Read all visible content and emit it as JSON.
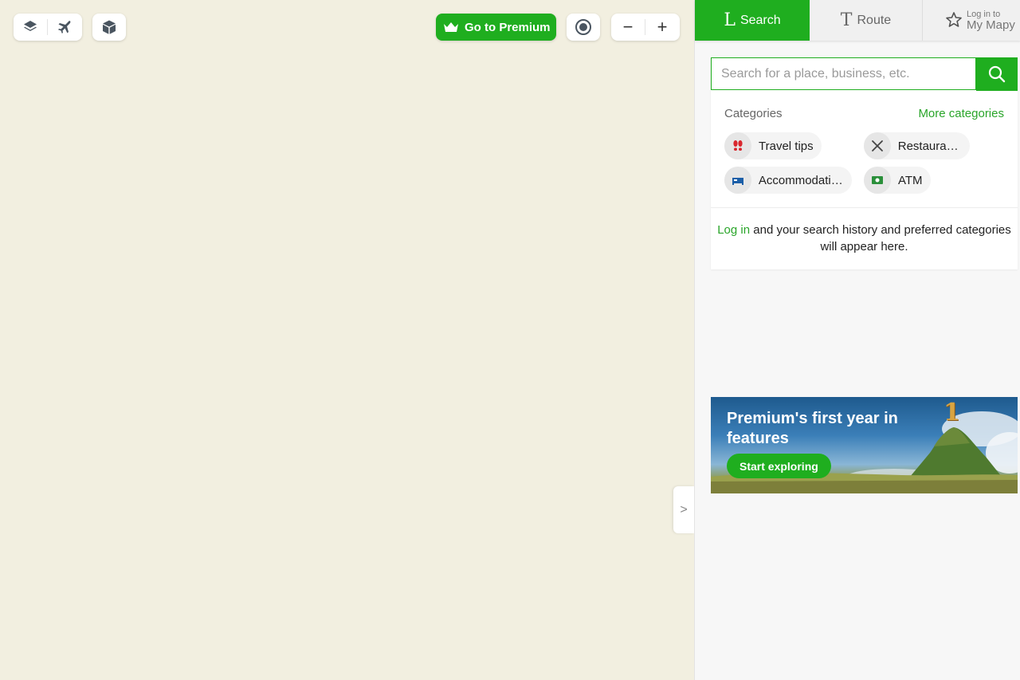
{
  "map_controls": {
    "layers_icon": "layers-icon",
    "flight_icon": "airplane-icon",
    "three_d_icon": "cube-icon",
    "premium_label": "Go to Premium",
    "premium_icon": "crown-icon",
    "locate_icon": "locate-icon",
    "zoom_out": "−",
    "zoom_in": "+",
    "collapse_label": ">"
  },
  "tabs": {
    "search_glyph": "L",
    "search_label": "Search",
    "route_glyph": "T",
    "route_label": "Route",
    "login_small": "Log in to",
    "login_big": "My Mapy"
  },
  "search": {
    "placeholder": "Search for a place, business, etc."
  },
  "categories": {
    "heading": "Categories",
    "more": "More categories",
    "items": [
      {
        "label": "Travel tips",
        "icon": "footprints-icon"
      },
      {
        "label": "Restaurants",
        "icon": "cutlery-icon"
      },
      {
        "label": "Accommodation",
        "icon": "bed-icon"
      },
      {
        "label": "ATM",
        "icon": "atm-icon"
      }
    ]
  },
  "login_note": {
    "link": "Log in",
    "text": " and your search history and preferred categories will appear here."
  },
  "promo": {
    "title": "Premium's first year in features",
    "cta": "Start exploring",
    "badge": "1"
  },
  "colors": {
    "accent": "#1fae1f",
    "map_bg": "#f2efe0"
  }
}
